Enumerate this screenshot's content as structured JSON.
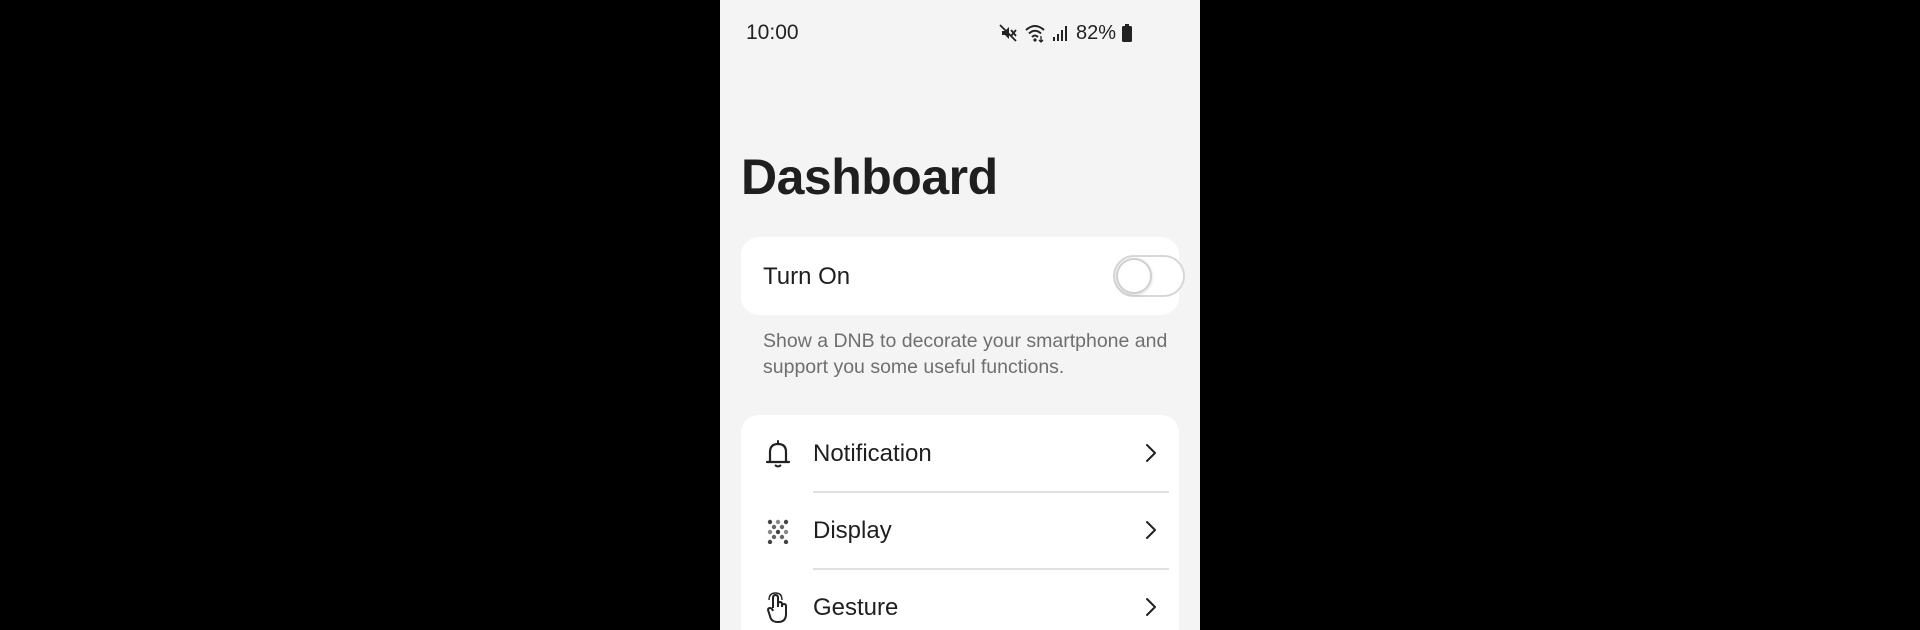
{
  "status_bar": {
    "time": "10:00",
    "battery": "82%",
    "icons": [
      "mute-icon",
      "wifi-icon",
      "signal-icon",
      "battery-icon"
    ]
  },
  "page": {
    "title": "Dashboard"
  },
  "toggle_card": {
    "label": "Turn On",
    "enabled": false
  },
  "description": "Show a DNB to decorate your smartphone and support you some useful functions.",
  "menu": {
    "items": [
      {
        "label": "Notification",
        "icon": "bell-icon"
      },
      {
        "label": "Display",
        "icon": "dots-grid-icon"
      },
      {
        "label": "Gesture",
        "icon": "hand-pointer-icon"
      }
    ]
  },
  "colors": {
    "outer_background": "#000000",
    "screen_background": "#f4f4f4",
    "card_background": "#ffffff",
    "primary_text": "#1f1f1f",
    "secondary_text": "#6f6f6f"
  }
}
